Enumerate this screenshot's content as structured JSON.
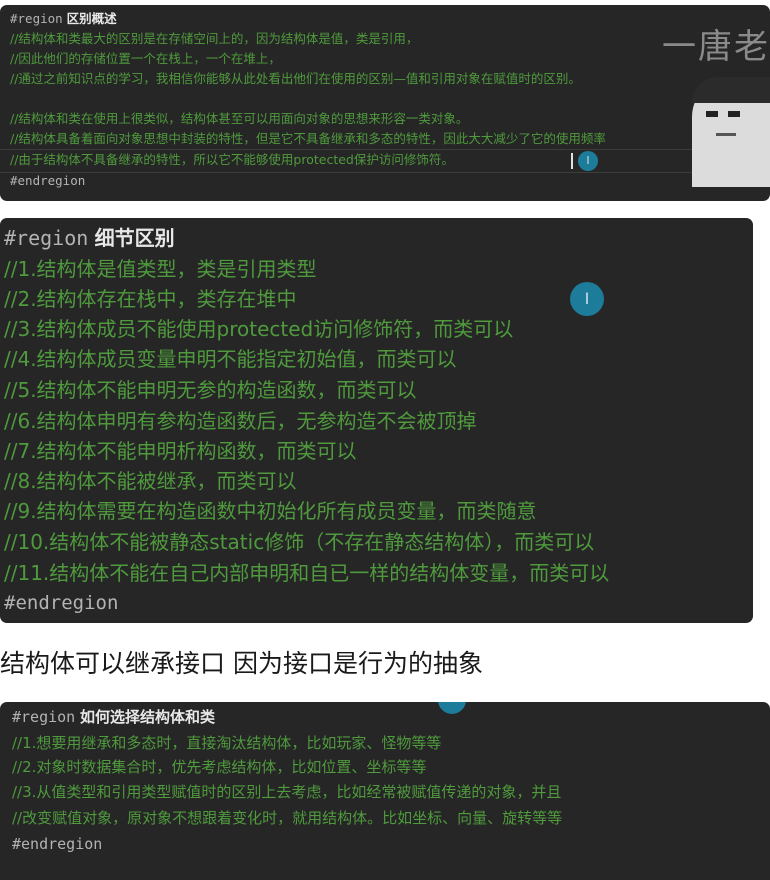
{
  "panel1": {
    "lines": [
      {
        "kw": "#region",
        "text": "区别概述"
      },
      {
        "comment": "//结构体和类最大的区别是在存储空间上的，因为结构体是值，类是引用，"
      },
      {
        "comment": "//因此他们的存储位置一个在栈上，一个在堆上，"
      },
      {
        "comment": "//通过之前知识点的学习，我相信你能够从此处看出他们在使用的区别—值和引用对象在赋值时的区别。"
      },
      {
        "comment": ""
      },
      {
        "comment": "//结构体和类在使用上很类似，结构体甚至可以用面向对象的思想来形容一类对象。"
      },
      {
        "comment": "//结构体具备着面向对象思想中封装的特性，但是它不具备继承和多态的特性，因此大大减少了它的使用频率"
      },
      {
        "comment": "//由于结构体不具备继承的特性，所以它不能够使用protected保护访问修饰符。"
      },
      {
        "kw": "#endregion"
      }
    ],
    "watermark": "一唐老狮"
  },
  "panel2": {
    "title_kw": "#region",
    "title": "细节区别",
    "items": [
      "//1.结构体是值类型，类是引用类型",
      "//2.结构体存在栈中，类存在堆中",
      "//3.结构体成员不能使用protected访问修饰符，而类可以",
      "//4.结构体成员变量申明不能指定初始值，而类可以",
      "//5.结构体不能申明无参的构造函数，而类可以",
      "//6.结构体申明有参构造函数后，无参构造不会被顶掉",
      "//7.结构体不能申明析构函数，而类可以",
      "//8.结构体不能被继承，而类可以",
      "//9.结构体需要在构造函数中初始化所有成员变量，而类随意",
      "//10.结构体不能被静态static修饰（不存在静态结构体），而类可以",
      "//11.结构体不能在自己内部申明和自已一样的结构体变量，而类可以"
    ],
    "end_kw": "#endregion"
  },
  "paragraph": "结构体可以继承接口 因为接口是行为的抽象",
  "panel3": {
    "title_kw": "#region",
    "title": "如何选择结构体和类",
    "items": [
      "//1.想要用继承和多态时，直接淘汰结构体，比如玩家、怪物等等",
      "//2.对象时数据集合时，优先考虑结构体，比如位置、坐标等等",
      "//3.从值类型和引用类型赋值时的区别上去考虑，比如经常被赋值传递的对象，并且",
      "//改变赋值对象，原对象不想跟着变化时，就用结构体。比如坐标、向量、旋转等等"
    ],
    "end_kw": "#endregion"
  },
  "colors": {
    "panel_bg": "#262626",
    "comment": "#4f9a3d",
    "keyword": "#b3b3b3",
    "cursor": "#1e86a8"
  }
}
